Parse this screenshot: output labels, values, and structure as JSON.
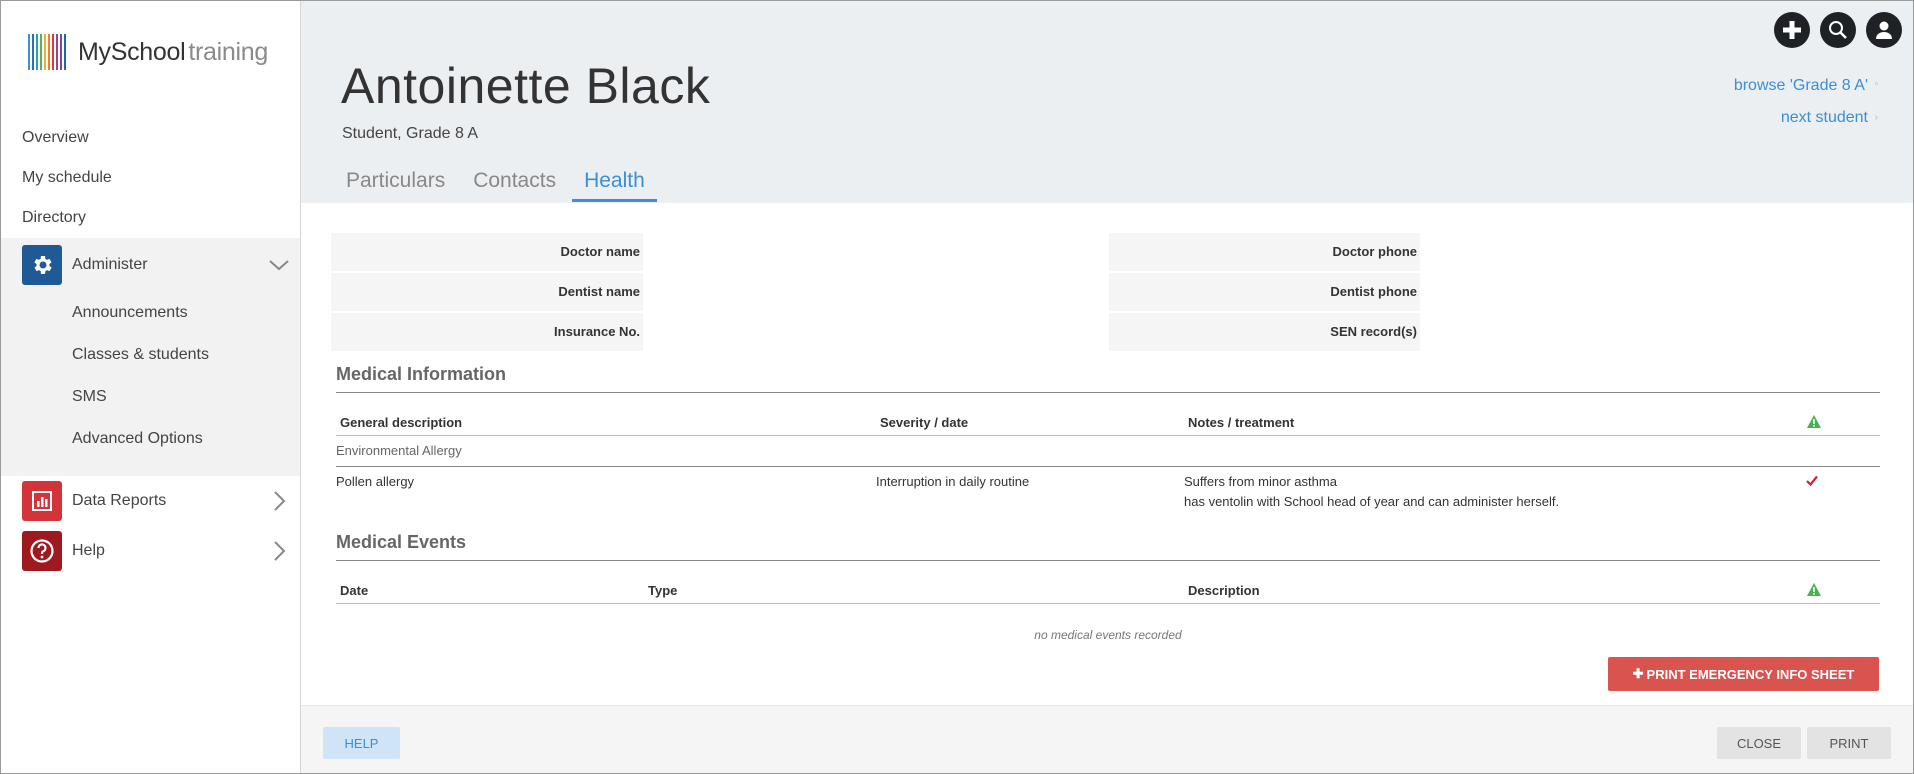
{
  "logo": {
    "brand": "MySchool",
    "suffix": "training",
    "bar_colors": [
      "#3b8ed4",
      "#2b6fb5",
      "#23a3b5",
      "#57b356",
      "#e8b432",
      "#ef7f2b",
      "#d9383f",
      "#a23e8c",
      "#6b4ea8",
      "#1d6aa8"
    ]
  },
  "sidebar": {
    "items": [
      {
        "label": "Overview"
      },
      {
        "label": "My schedule"
      },
      {
        "label": "Directory"
      }
    ],
    "administer": {
      "label": "Administer",
      "sub_items": [
        {
          "label": "Announcements"
        },
        {
          "label": "Classes & students"
        },
        {
          "label": "SMS"
        },
        {
          "label": "Advanced Options"
        }
      ]
    },
    "data_reports": {
      "label": "Data Reports"
    },
    "help": {
      "label": "Help"
    }
  },
  "header": {
    "name": "Antoinette Black",
    "subtitle": "Student, Grade 8 A",
    "browse_link": "browse 'Grade 8 A'",
    "next_link": "next student",
    "icons": [
      "add-icon",
      "search-icon",
      "user-icon"
    ]
  },
  "tabs": [
    {
      "label": "Particulars"
    },
    {
      "label": "Contacts"
    },
    {
      "label": "Health",
      "active": true
    }
  ],
  "health_fields": {
    "doctor_name": "Doctor name",
    "dentist_name": "Dentist name",
    "insurance_no": "Insurance No.",
    "doctor_phone": "Doctor phone",
    "dentist_phone": "Dentist phone",
    "sen_records": "SEN record(s)"
  },
  "medical_information": {
    "title": "Medical Information",
    "columns": [
      "General description",
      "Severity / date",
      "Notes / treatment"
    ],
    "groups": [
      {
        "label": "Environmental Allergy",
        "rows": [
          {
            "description": "Pollen allergy",
            "severity": "Interruption in daily routine",
            "notes_line1": "Suffers from minor asthma",
            "notes_line2": "has ventolin with School head of year and can administer herself.",
            "flagged": true
          }
        ]
      }
    ]
  },
  "medical_events": {
    "title": "Medical Events",
    "columns": [
      "Date",
      "Type",
      "Description"
    ],
    "empty_text": "no medical events recorded"
  },
  "buttons": {
    "print_emergency": "PRINT EMERGENCY INFO SHEET",
    "help": "HELP",
    "close": "CLOSE",
    "print": "PRINT"
  },
  "colors": {
    "accent": "#3a8fd6",
    "danger": "#d9534f",
    "warning_green": "#4caf50",
    "check_red": "#c62828"
  }
}
